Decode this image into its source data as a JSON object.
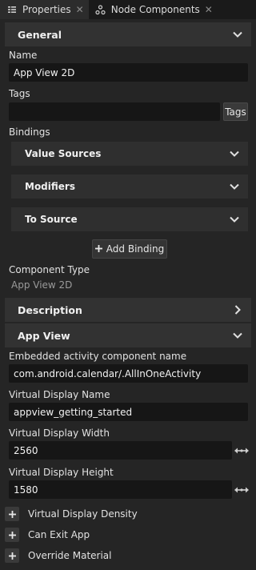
{
  "tabs": [
    {
      "label": "Properties",
      "close": "✕"
    },
    {
      "label": "Node Components",
      "close": "✕"
    }
  ],
  "general": {
    "title": "General",
    "name_label": "Name",
    "name_value": "App View 2D",
    "tags_label": "Tags",
    "tags_value": "",
    "tags_button": "Tags",
    "bindings_label": "Bindings",
    "value_sources": "Value Sources",
    "modifiers": "Modifiers",
    "to_source": "To Source",
    "add_binding": "Add Binding",
    "component_type_label": "Component Type",
    "component_type_value": "App View 2D"
  },
  "description": {
    "title": "Description"
  },
  "app_view": {
    "title": "App View",
    "activity_label": "Embedded activity component name",
    "activity_value": "com.android.calendar/.AllInOneActivity",
    "display_name_label": "Virtual Display Name",
    "display_name_value": "appview_getting_started",
    "width_label": "Virtual Display Width",
    "width_value": "2560",
    "height_label": "Virtual Display Height",
    "height_value": "1580"
  },
  "extra_props": [
    {
      "label": "Virtual Display Density"
    },
    {
      "label": "Can Exit App"
    },
    {
      "label": "Override Material"
    }
  ],
  "icons": {
    "properties_tab": "properties-icon",
    "node_components_tab": "node-components-icon",
    "expand": "chevron-down-icon",
    "collapsed": "chevron-right-icon",
    "plus": "plus-icon",
    "drag": "drag-arrows-icon"
  }
}
